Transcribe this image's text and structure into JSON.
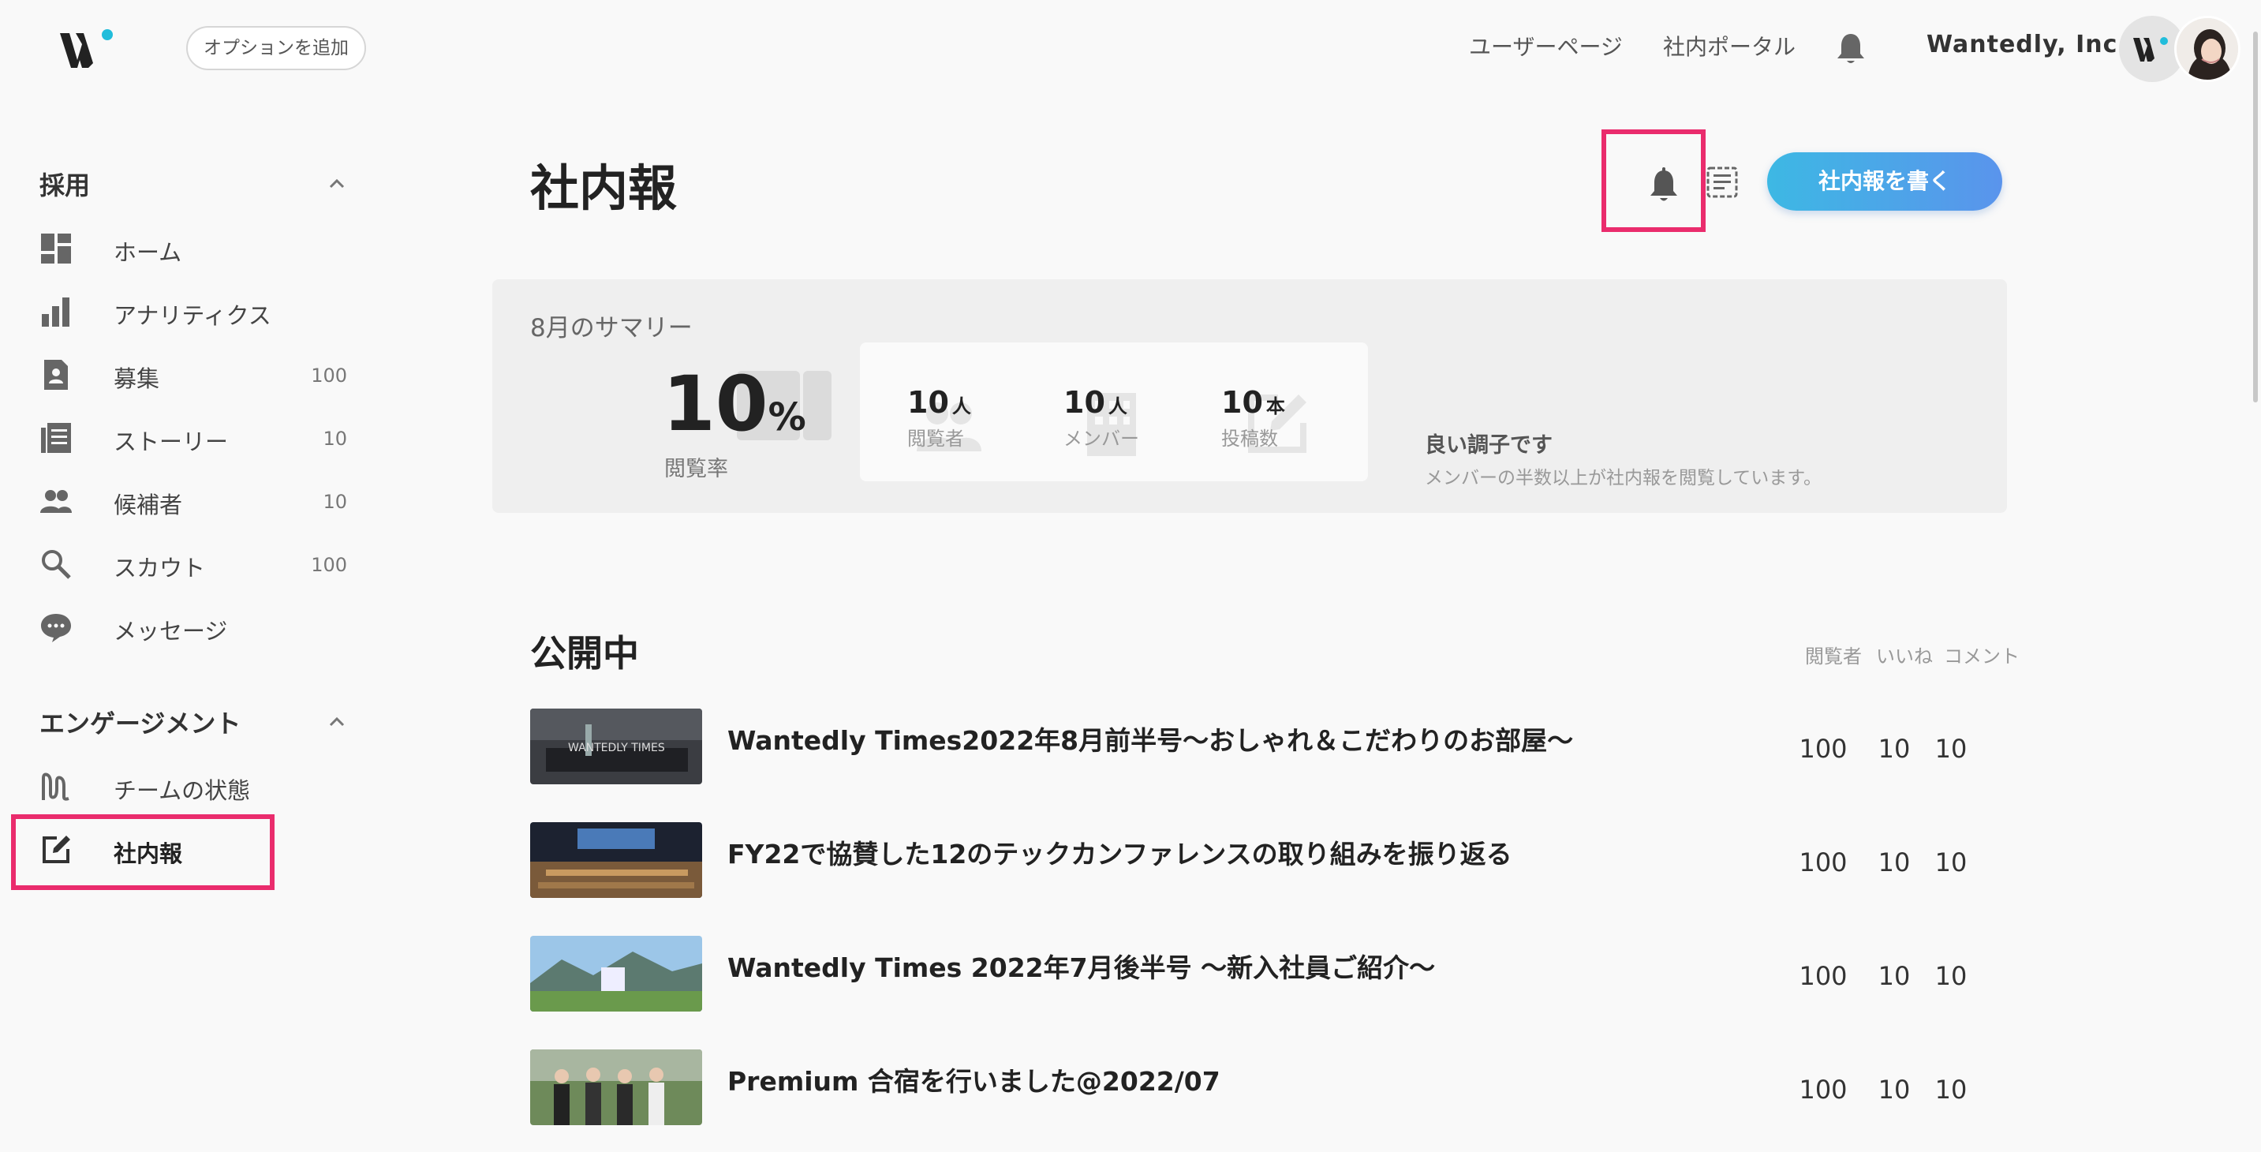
{
  "topbar": {
    "option_button": "オプションを追加",
    "nav": [
      "ユーザーページ",
      "社内ポータル"
    ],
    "company": "Wantedly, Inc."
  },
  "sidebar": {
    "sections": [
      {
        "title": "採用",
        "items": [
          {
            "label": "ホーム",
            "icon": "dashboard-icon",
            "count": ""
          },
          {
            "label": "アナリティクス",
            "icon": "bar-chart-icon",
            "count": ""
          },
          {
            "label": "募集",
            "icon": "document-person-icon",
            "count": "100"
          },
          {
            "label": "ストーリー",
            "icon": "article-icon",
            "count": "10"
          },
          {
            "label": "候補者",
            "icon": "people-icon",
            "count": "10"
          },
          {
            "label": "スカウト",
            "icon": "search-icon",
            "count": "100"
          },
          {
            "label": "メッセージ",
            "icon": "chat-bubble-icon",
            "count": ""
          }
        ]
      },
      {
        "title": "エンゲージメント",
        "items": [
          {
            "label": "チームの状態",
            "icon": "wave-icon",
            "count": ""
          },
          {
            "label": "社内報",
            "icon": "edit-square-icon",
            "count": ""
          }
        ]
      }
    ]
  },
  "main": {
    "title": "社内報",
    "write_button": "社内報を書く",
    "summary": {
      "title": "8月のサマリー",
      "rate_value": "10",
      "rate_unit": "%",
      "rate_label": "閲覧率",
      "stats": [
        {
          "value": "10",
          "unit": "人",
          "label": "閲覧者"
        },
        {
          "value": "10",
          "unit": "人",
          "label": "メンバー"
        },
        {
          "value": "10",
          "unit": "本",
          "label": "投稿数"
        }
      ],
      "status_title": "良い調子です",
      "status_desc": "メンバーの半数以上が社内報を閲覧しています。"
    },
    "published": {
      "title": "公開中",
      "columns": [
        "閲覧者",
        "いいね",
        "コメント"
      ],
      "posts": [
        {
          "title": "Wantedly Times2022年8月前半号〜おしゃれ＆こだわりのお部屋〜",
          "viewers": "100",
          "likes": "10",
          "comments": "10"
        },
        {
          "title": "FY22で協賛した12のテックカンファレンスの取り組みを振り返る",
          "viewers": "100",
          "likes": "10",
          "comments": "10"
        },
        {
          "title": "Wantedly Times 2022年7月後半号 〜新入社員ご紹介〜",
          "viewers": "100",
          "likes": "10",
          "comments": "10"
        },
        {
          "title": "Premium 合宿を行いました@2022/07",
          "viewers": "100",
          "likes": "10",
          "comments": "10"
        }
      ]
    }
  },
  "colors": {
    "highlight": "#ea2c6d",
    "button_gradient_start": "#3db8e4",
    "button_gradient_end": "#5a94ec",
    "brand_dot": "#21bddb"
  }
}
